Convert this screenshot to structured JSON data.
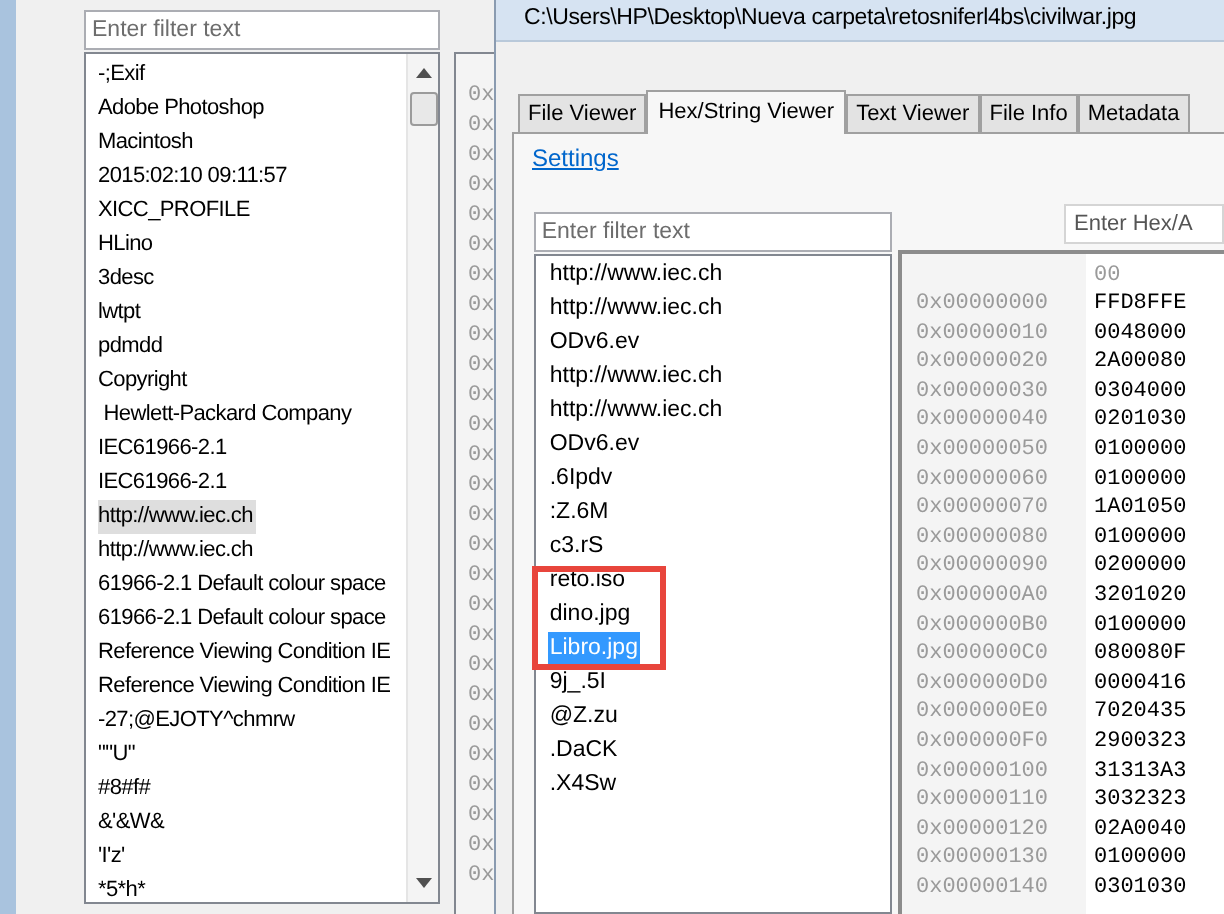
{
  "left_window": {
    "filter": {
      "placeholder": "Enter filter text"
    },
    "strings": [
      {
        "text": "-;Exif",
        "highlighted": false
      },
      {
        "text": "Adobe Photoshop",
        "highlighted": false
      },
      {
        "text": "Macintosh",
        "highlighted": false
      },
      {
        "text": "2015:02:10 09:11:57",
        "highlighted": false
      },
      {
        "text": "XICC_PROFILE",
        "highlighted": false
      },
      {
        "text": "HLino",
        "highlighted": false
      },
      {
        "text": "3desc",
        "highlighted": false
      },
      {
        "text": "lwtpt",
        "highlighted": false
      },
      {
        "text": "pdmdd",
        "highlighted": false
      },
      {
        "text": "Copyright",
        "highlighted": false
      },
      {
        "text": " Hewlett-Packard Company",
        "highlighted": false
      },
      {
        "text": "IEC61966-2.1",
        "highlighted": false
      },
      {
        "text": "IEC61966-2.1",
        "highlighted": false
      },
      {
        "text": "http://www.iec.ch",
        "highlighted": true
      },
      {
        "text": "http://www.iec.ch",
        "highlighted": false
      },
      {
        "text": "61966-2.1 Default colour space",
        "highlighted": false
      },
      {
        "text": "61966-2.1 Default colour space",
        "highlighted": false
      },
      {
        "text": "Reference Viewing Condition IE",
        "highlighted": false
      },
      {
        "text": "Reference Viewing Condition IE",
        "highlighted": false
      },
      {
        "text": "-27;@EJOTY^chmrw",
        "highlighted": false
      },
      {
        "text": "\"\"U\"",
        "highlighted": false
      },
      {
        "text": "#8#f#",
        "highlighted": false
      },
      {
        "text": "&'&W&",
        "highlighted": false
      },
      {
        "text": "'I'z'",
        "highlighted": false
      },
      {
        "text": "*5*h*",
        "highlighted": false
      }
    ],
    "hex_offsets_cut": [
      "0x",
      "0x",
      "0x",
      "0x",
      "0x",
      "0x",
      "0x",
      "0x",
      "0x",
      "0x",
      "0x",
      "0x",
      "0x",
      "0x",
      "0x",
      "0x",
      "0x",
      "0x",
      "0x",
      "0x",
      "0x",
      "0x",
      "0x",
      "0x",
      "0x",
      "0x",
      "0x"
    ]
  },
  "right_window": {
    "title": "C:\\Users\\HP\\Desktop\\Nueva carpeta\\retosniferl4bs\\civilwar.jpg",
    "tabs": [
      {
        "label": "File Viewer",
        "selected": false
      },
      {
        "label": "Hex/String Viewer",
        "selected": true
      },
      {
        "label": "Text Viewer",
        "selected": false
      },
      {
        "label": "File Info",
        "selected": false
      },
      {
        "label": "Metadata",
        "selected": false
      }
    ],
    "settings_link": "Settings",
    "filter": {
      "placeholder": "Enter filter text"
    },
    "strings": [
      {
        "text": "http://www.iec.ch",
        "selected": false
      },
      {
        "text": "http://www.iec.ch",
        "selected": false
      },
      {
        "text": "ODv6.ev",
        "selected": false
      },
      {
        "text": "http://www.iec.ch",
        "selected": false
      },
      {
        "text": "http://www.iec.ch",
        "selected": false
      },
      {
        "text": "ODv6.ev",
        "selected": false
      },
      {
        "text": ".6Ipdv",
        "selected": false
      },
      {
        "text": ":Z.6M",
        "selected": false
      },
      {
        "text": "c3.rS",
        "selected": false
      },
      {
        "text": "reto.iso",
        "selected": false
      },
      {
        "text": "dino.jpg",
        "selected": false
      },
      {
        "text": "Libro.jpg",
        "selected": true
      },
      {
        "text": "9j_.5I",
        "selected": false
      },
      {
        "text": "@Z.zu",
        "selected": false
      },
      {
        "text": ".DaCK",
        "selected": false
      },
      {
        "text": ".X4Sw",
        "selected": false
      }
    ],
    "hex_search": {
      "placeholder": "Enter Hex/A"
    },
    "hex_header": "00",
    "hex_rows": [
      {
        "offset": "0x00000000",
        "value": "FFD8FFE"
      },
      {
        "offset": "0x00000010",
        "value": "0048000"
      },
      {
        "offset": "0x00000020",
        "value": "2A00080"
      },
      {
        "offset": "0x00000030",
        "value": "0304000"
      },
      {
        "offset": "0x00000040",
        "value": "0201030"
      },
      {
        "offset": "0x00000050",
        "value": "0100000"
      },
      {
        "offset": "0x00000060",
        "value": "0100000"
      },
      {
        "offset": "0x00000070",
        "value": "1A01050"
      },
      {
        "offset": "0x00000080",
        "value": "0100000"
      },
      {
        "offset": "0x00000090",
        "value": "0200000"
      },
      {
        "offset": "0x000000A0",
        "value": "3201020"
      },
      {
        "offset": "0x000000B0",
        "value": "0100000"
      },
      {
        "offset": "0x000000C0",
        "value": "080080F"
      },
      {
        "offset": "0x000000D0",
        "value": "0000416"
      },
      {
        "offset": "0x000000E0",
        "value": "7020435"
      },
      {
        "offset": "0x000000F0",
        "value": "2900323"
      },
      {
        "offset": "0x00000100",
        "value": "31313A3"
      },
      {
        "offset": "0x00000110",
        "value": "3032323"
      },
      {
        "offset": "0x00000120",
        "value": "02A0040"
      },
      {
        "offset": "0x00000130",
        "value": "0100000"
      },
      {
        "offset": "0x00000140",
        "value": "0301030"
      }
    ]
  }
}
